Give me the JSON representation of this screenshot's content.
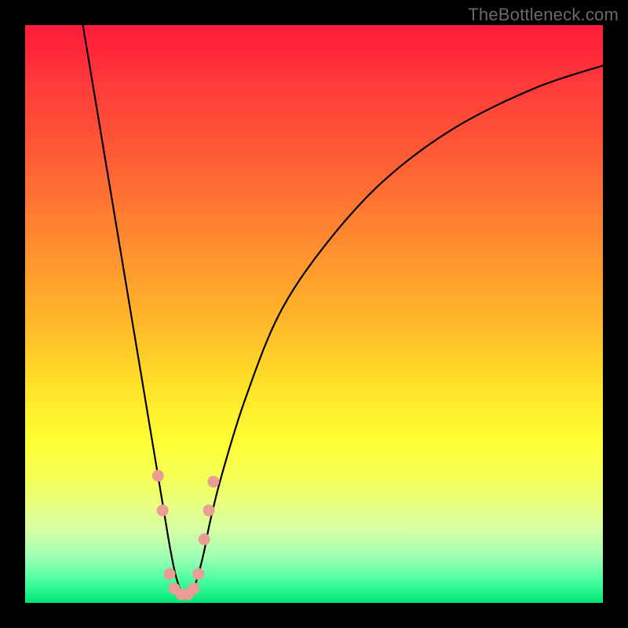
{
  "watermark": "TheBottleneck.com",
  "chart_data": {
    "type": "line",
    "title": "",
    "xlabel": "",
    "ylabel": "",
    "xlim": [
      0,
      100
    ],
    "ylim": [
      0,
      100
    ],
    "grid": false,
    "background_gradient": {
      "top": "#ff1a3a",
      "mid": "#ffff33",
      "bottom": "#00e878"
    },
    "series": [
      {
        "name": "bottleneck-curve",
        "color": "#000000",
        "x": [
          10,
          12,
          14,
          16,
          18,
          20,
          22,
          23,
          24,
          25,
          26,
          27,
          28,
          29,
          30,
          31,
          32,
          34,
          38,
          44,
          52,
          62,
          74,
          88,
          100
        ],
        "values": [
          100,
          88,
          76,
          64,
          52,
          40,
          28,
          22,
          16,
          10,
          5,
          2,
          1,
          2,
          5,
          9,
          14,
          22,
          35,
          50,
          62,
          73,
          82,
          89,
          93
        ]
      }
    ],
    "markers": {
      "name": "highlight-dots",
      "color": "#e99d94",
      "points": [
        {
          "x": 23.0,
          "y": 22
        },
        {
          "x": 23.8,
          "y": 16
        },
        {
          "x": 25.0,
          "y": 5
        },
        {
          "x": 25.8,
          "y": 2.5
        },
        {
          "x": 27.0,
          "y": 1.5
        },
        {
          "x": 28.2,
          "y": 1.5
        },
        {
          "x": 29.2,
          "y": 2.5
        },
        {
          "x": 30.0,
          "y": 5
        },
        {
          "x": 31.0,
          "y": 11
        },
        {
          "x": 31.8,
          "y": 16
        },
        {
          "x": 32.6,
          "y": 21
        }
      ]
    }
  }
}
